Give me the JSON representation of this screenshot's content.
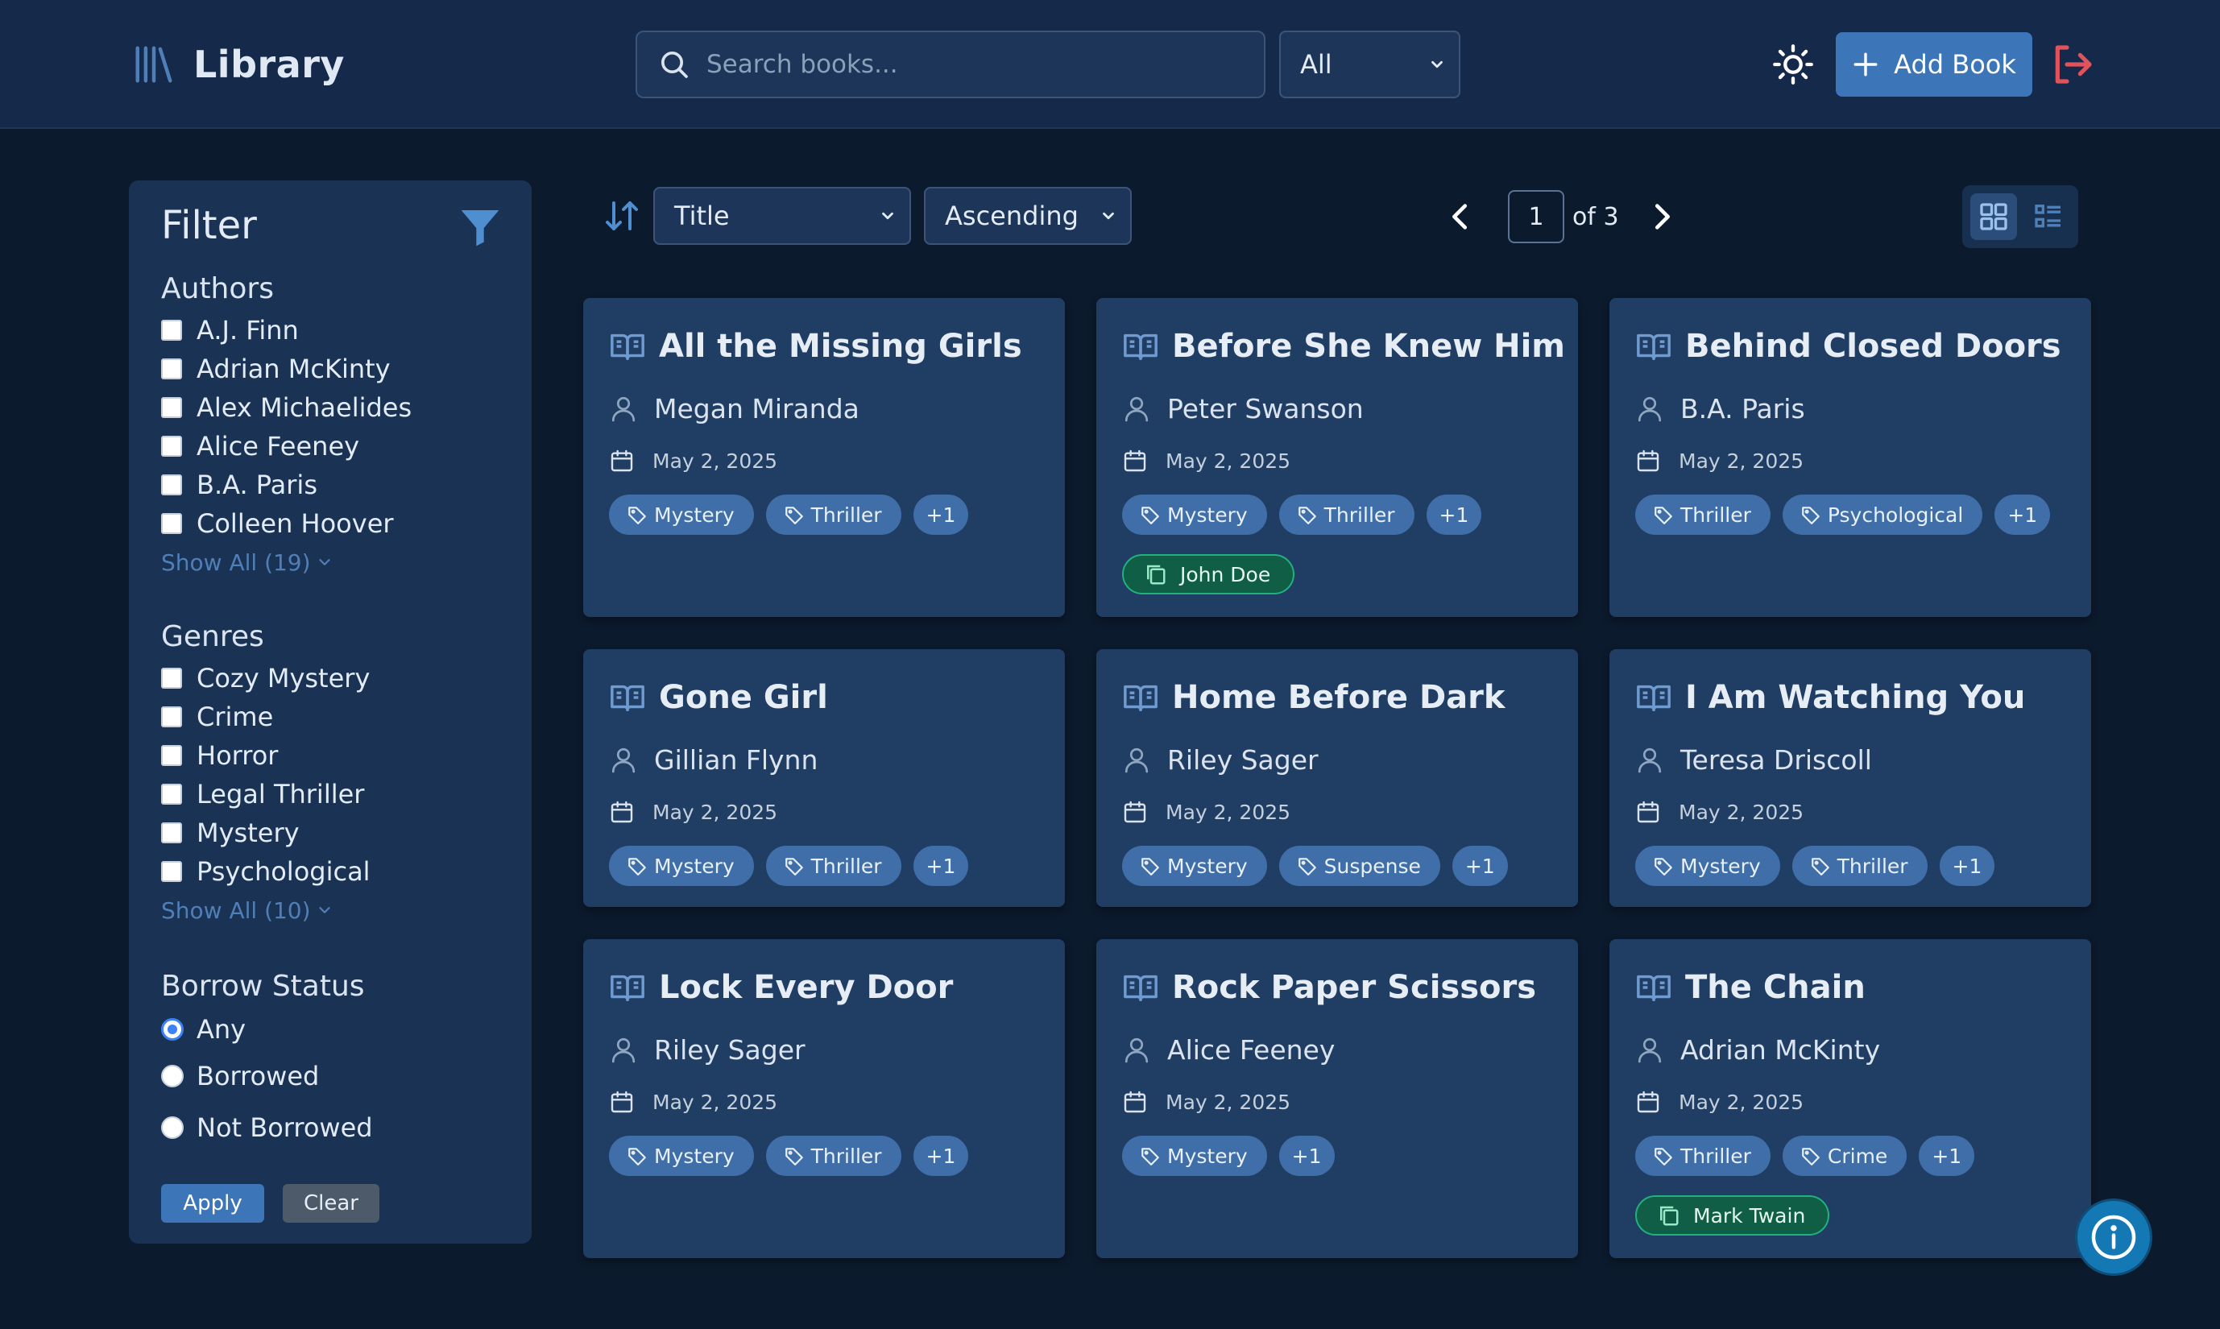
{
  "header": {
    "app_title": "Library",
    "search_placeholder": "Search books...",
    "search_value": "",
    "type_filter": "All",
    "add_book_label": "Add Book"
  },
  "filter": {
    "title": "Filter",
    "authors": {
      "heading": "Authors",
      "items": [
        "A.J. Finn",
        "Adrian McKinty",
        "Alex Michaelides",
        "Alice Feeney",
        "B.A. Paris",
        "Colleen Hoover"
      ],
      "show_all": "Show All (19)"
    },
    "genres": {
      "heading": "Genres",
      "items": [
        "Cozy Mystery",
        "Crime",
        "Horror",
        "Legal Thriller",
        "Mystery",
        "Psychological"
      ],
      "show_all": "Show All (10)"
    },
    "borrow_status": {
      "heading": "Borrow Status",
      "options": [
        "Any",
        "Borrowed",
        "Not Borrowed"
      ],
      "selected": "Any"
    },
    "apply_label": "Apply",
    "clear_label": "Clear"
  },
  "toolbar": {
    "sort_field": "Title",
    "sort_direction": "Ascending",
    "current_page": "1",
    "page_total": "of 3",
    "view_mode": "grid"
  },
  "books": [
    {
      "title": "All the Missing Girls",
      "author": "Megan Miranda",
      "date": "May 2, 2025",
      "tags": [
        "Mystery",
        "Thriller"
      ],
      "more": "+1",
      "borrower": ""
    },
    {
      "title": "Before She Knew Him",
      "author": "Peter Swanson",
      "date": "May 2, 2025",
      "tags": [
        "Mystery",
        "Thriller"
      ],
      "more": "+1",
      "borrower": "John Doe"
    },
    {
      "title": "Behind Closed Doors",
      "author": "B.A. Paris",
      "date": "May 2, 2025",
      "tags": [
        "Thriller",
        "Psychological"
      ],
      "more": "+1",
      "borrower": ""
    },
    {
      "title": "Gone Girl",
      "author": "Gillian Flynn",
      "date": "May 2, 2025",
      "tags": [
        "Mystery",
        "Thriller"
      ],
      "more": "+1",
      "borrower": ""
    },
    {
      "title": "Home Before Dark",
      "author": "Riley Sager",
      "date": "May 2, 2025",
      "tags": [
        "Mystery",
        "Suspense"
      ],
      "more": "+1",
      "borrower": ""
    },
    {
      "title": "I Am Watching You",
      "author": "Teresa Driscoll",
      "date": "May 2, 2025",
      "tags": [
        "Mystery",
        "Thriller"
      ],
      "more": "+1",
      "borrower": ""
    },
    {
      "title": "Lock Every Door",
      "author": "Riley Sager",
      "date": "May 2, 2025",
      "tags": [
        "Mystery",
        "Thriller"
      ],
      "more": "+1",
      "borrower": ""
    },
    {
      "title": "Rock Paper Scissors",
      "author": "Alice Feeney",
      "date": "May 2, 2025",
      "tags": [
        "Mystery"
      ],
      "more": "+1",
      "borrower": ""
    },
    {
      "title": "The Chain",
      "author": "Adrian McKinty",
      "date": "May 2, 2025",
      "tags": [
        "Thriller",
        "Crime"
      ],
      "more": "+1",
      "borrower": "Mark Twain"
    }
  ],
  "colors": {
    "background": "#0c1a2d",
    "header": "#15294a",
    "card": "#203d63",
    "accent": "#3d76b8",
    "tag": "#3f6ea8",
    "borrowed_badge": "#0f5e45",
    "logout": "#e0535c"
  },
  "icons": {
    "logo": "library-books-icon",
    "search": "search-icon",
    "theme": "sun-icon",
    "add": "plus-icon",
    "logout": "logout-icon",
    "filter": "funnel-icon",
    "sort": "sort-arrows-icon",
    "card_title": "open-book-icon",
    "author": "user-icon",
    "date": "calendar-icon",
    "tag": "tag-icon",
    "borrower": "copy-icon",
    "info": "info-icon"
  }
}
